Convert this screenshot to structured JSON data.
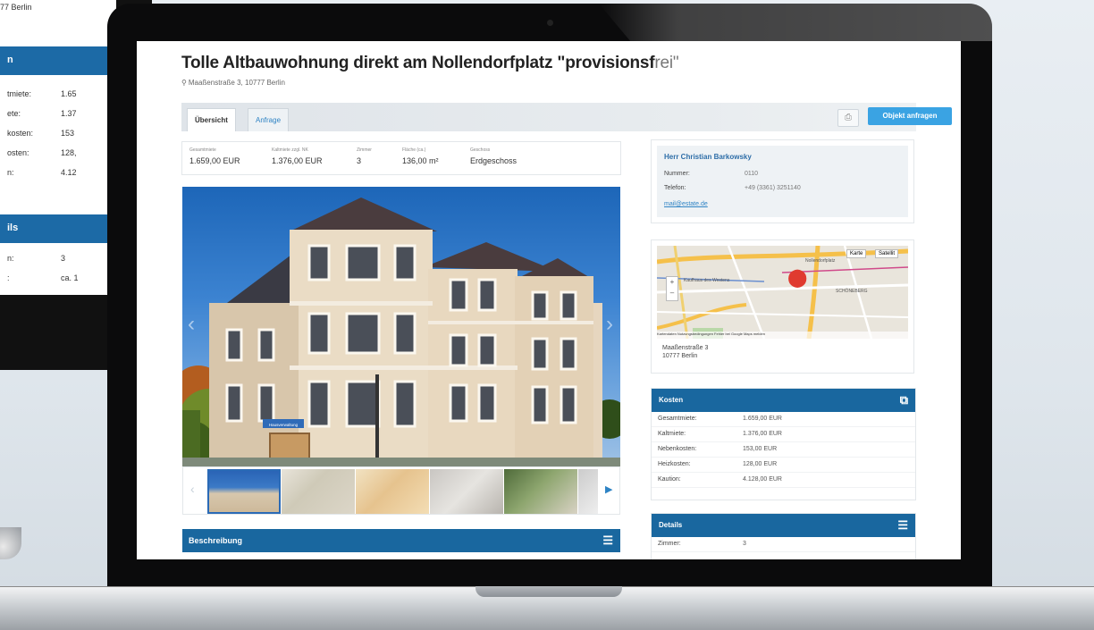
{
  "background_device": {
    "address_line1": "...",
    "address_line2": "77 Berlin",
    "costs_header": "n",
    "costs_rows": [
      {
        "label": "tmiete:",
        "value": "1.65"
      },
      {
        "label": "ete:",
        "value": "1.37"
      },
      {
        "label": "kosten:",
        "value": "153"
      },
      {
        "label": "osten:",
        "value": "128,"
      },
      {
        "label": "n:",
        "value": "4.12"
      }
    ],
    "details_header": "ils",
    "details_rows": [
      {
        "label": "n:",
        "value": "3"
      },
      {
        "label": ":",
        "value": "ca. 1"
      }
    ]
  },
  "listing": {
    "title_main": "Tolle Altbauwohnung direkt am Nollendorfplatz \"provisionsf",
    "title_tail": "rei\"",
    "address": "Maaßenstraße 3, 10777 Berlin"
  },
  "tabs": [
    {
      "label": "Übersicht",
      "active": true
    },
    {
      "label": "Anfrage",
      "active": false
    }
  ],
  "toolbar": {
    "print_icon": "print-icon",
    "contact_button": "Objekt anfragen"
  },
  "facts": [
    {
      "label": "Gesamtmiete",
      "value": "1.659,00 EUR"
    },
    {
      "label": "Kaltmiete zzgl. NK",
      "value": "1.376,00 EUR"
    },
    {
      "label": "Zimmer",
      "value": "3"
    },
    {
      "label": "Fläche (ca.)",
      "value": "136,00 m²"
    },
    {
      "label": "Geschoss",
      "value": "Erdgeschoss"
    }
  ],
  "gallery": {
    "prev_arrow": "‹",
    "next_arrow": "›",
    "thumb_prev": "‹",
    "thumb_next": "▶",
    "sign_text": "Hausverwaltung"
  },
  "description": {
    "header": "Beschreibung"
  },
  "contact": {
    "name": "Herr Christian Barkowsky",
    "rows": [
      {
        "label": "Nummer:",
        "value": "0110"
      },
      {
        "label": "Telefon:",
        "value": "+49 (3361) 3251140"
      }
    ],
    "email": "mail@estate.de"
  },
  "map": {
    "type_map": "Karte",
    "type_satellite": "Satellit",
    "zoom_in": "+",
    "zoom_out": "–",
    "label_1": "Kaufhaus des Westens",
    "label_2": "Nollendorfplatz",
    "label_3": "SCHÖNEBERG",
    "footer": "Kartendaten  Nutzungsbedingungen  Fehler bei Google Maps melden",
    "address_line1": "Maaßenstraße 3",
    "address_line2": "10777 Berlin"
  },
  "costs": {
    "header": "Kosten",
    "rows": [
      {
        "label": "Gesamtmiete:",
        "value": "1.659,00 EUR"
      },
      {
        "label": "Kaltmiete:",
        "value": "1.376,00 EUR"
      },
      {
        "label": "Nebenkosten:",
        "value": "153,00 EUR"
      },
      {
        "label": "Heizkosten:",
        "value": "128,00 EUR"
      },
      {
        "label": "Kaution:",
        "value": "4.128,00 EUR"
      }
    ]
  },
  "details": {
    "header": "Details",
    "rows": [
      {
        "label": "Zimmer:",
        "value": "3"
      }
    ]
  }
}
